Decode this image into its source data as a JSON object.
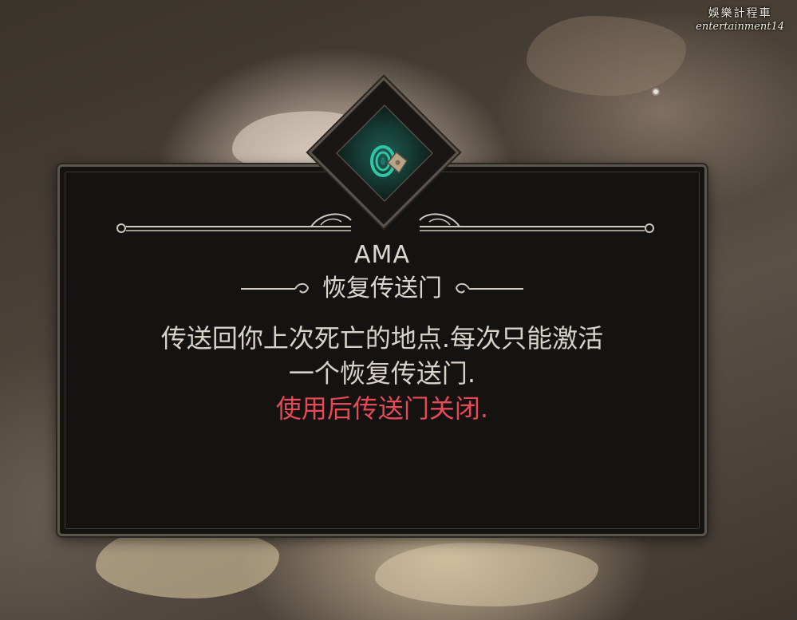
{
  "watermark": {
    "line1": "娛樂計程車",
    "line2": "entertainment14"
  },
  "tooltip": {
    "icon": "portal-swirl-icon",
    "title": "AMA",
    "subtitle": "恢复传送门",
    "description_line1": "传送回你上次死亡的地点.每次只能激活",
    "description_line2": "一个恢复传送门.",
    "warning": "使用后传送门关闭."
  },
  "colors": {
    "panel_bg": "#151212",
    "frame": "#5c554c",
    "text": "#dcd7ce",
    "warning": "#e64a55",
    "portal_glow": "#1f5a4f",
    "portal_icon": "#2fc5a6"
  }
}
